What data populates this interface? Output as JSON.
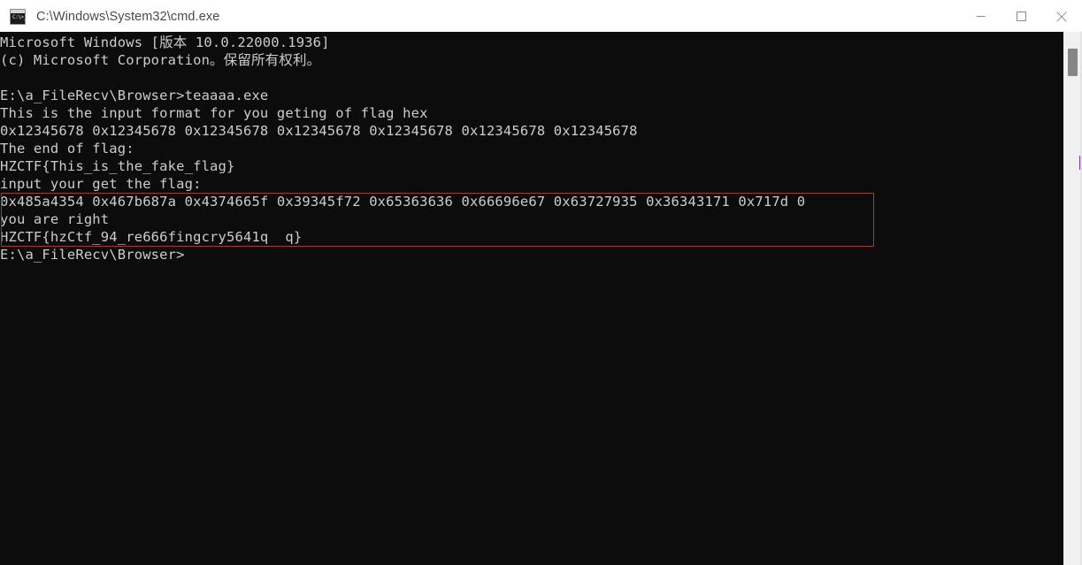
{
  "window": {
    "title": "C:\\Windows\\System32\\cmd.exe",
    "icon": "cmd-console-icon",
    "icon_glyph": "C:\\>_",
    "controls": {
      "minimize": "minimize-icon",
      "maximize": "maximize-icon",
      "close": "close-icon"
    }
  },
  "colors": {
    "console_background": "#0c0c0c",
    "console_text": "#cccccc",
    "titlebar_background": "#ffffff",
    "titlebar_text": "#4a4a4a",
    "annotation_box": "#e02020",
    "scrollbar_track": "#f0f0f0",
    "scrollbar_thumb": "#868686",
    "scroll_mark": "#8a2be2"
  },
  "console": {
    "lines": [
      "Microsoft Windows [版本 10.0.22000.1936]",
      "(c) Microsoft Corporation。保留所有权利。",
      "",
      "E:\\a_FileRecv\\Browser>teaaaa.exe",
      "This is the input format for you geting of flag hex",
      "0x12345678 0x12345678 0x12345678 0x12345678 0x12345678 0x12345678 0x12345678",
      "The end of flag:",
      "HZCTF{This_is_the_fake_flag}",
      "input your get the flag:",
      "0x485a4354 0x467b687a 0x4374665f 0x39345f72 0x65363636 0x66696e67 0x63727935 0x36343171 0x717d 0",
      "you are right",
      "HZCTF{hzCtf_94_re666fingcry5641q  q}",
      "E:\\a_FileRecv\\Browser>"
    ]
  },
  "annotation": {
    "highlighted_lines": [
      "0x485a4354 0x467b687a 0x4374665f 0x39345f72 0x65363636 0x66696e67 0x63727935 0x36343171 0x717d 0",
      "you are right",
      "HZCTF{hzCtf_94_re666fingcry5641q  q}"
    ]
  }
}
